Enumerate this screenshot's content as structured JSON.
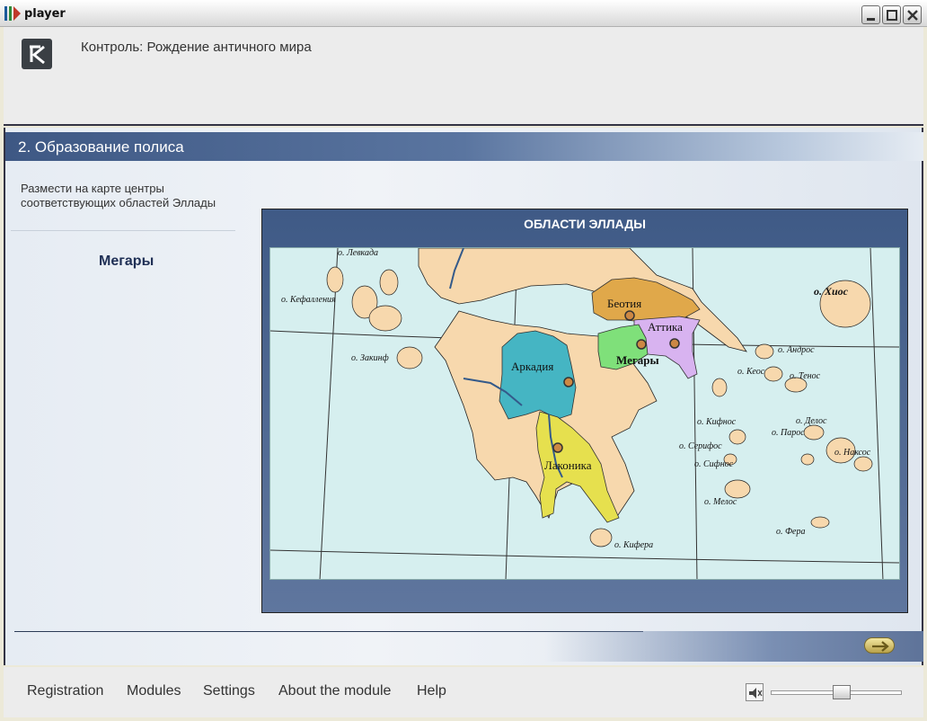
{
  "window": {
    "title": "player"
  },
  "header": {
    "title": "Контроль: Рождение античного мира"
  },
  "section": {
    "title": "2. Образование полиса"
  },
  "task": {
    "instruction": "Размести на карте центры соответствующих областей Эллады",
    "current_label": "Мегары"
  },
  "map": {
    "title": "ОБЛАСТИ ЭЛЛАДЫ",
    "regions": [
      "Беотия",
      "Аттика",
      "Мегары",
      "Аркадия",
      "Лаконика"
    ],
    "islands": [
      "о. Левкада",
      "о. Кефалления",
      "о. Закинф",
      "о. Хиос",
      "о. Андрос",
      "о. Кеос",
      "о. Тенос",
      "о. Кифнос",
      "о. Делос",
      "о. Парос",
      "о. Серифос",
      "о. Наксос",
      "о. Сифнос",
      "о. Мелос",
      "о. Фера",
      "о. Кифера"
    ]
  },
  "footer": {
    "menu": [
      "Registration",
      "Modules",
      "Settings",
      "About the module",
      "Help"
    ]
  },
  "volume": {
    "level": 0.55
  },
  "colors": {
    "land": "#f7d8ad",
    "sea": "#d6efef",
    "boeotia": "#e0a84a",
    "attica": "#d8b3f0",
    "megara": "#7fe07a",
    "arcadia": "#45b5c3",
    "laconia": "#e6e04e"
  }
}
